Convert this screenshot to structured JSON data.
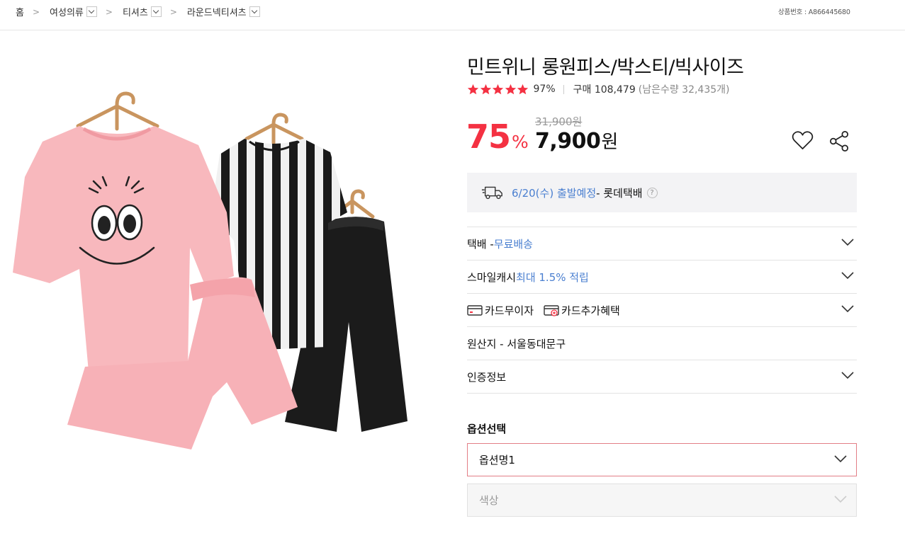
{
  "breadcrumb": {
    "items": [
      {
        "label": "홈",
        "has_dropdown": false
      },
      {
        "label": "여성의류",
        "has_dropdown": true
      },
      {
        "label": "티셔츠",
        "has_dropdown": true
      },
      {
        "label": "라운드넥티셔츠",
        "has_dropdown": true
      }
    ],
    "separator": ">"
  },
  "product_number": "상품번호 : A866445680",
  "product": {
    "title": "민트위니 롱원피스/박스티/빅사이즈",
    "rating_stars": 5,
    "rating_percent": "97%",
    "purchase_label": "구매 108,479",
    "remaining_label": "(남은수량 32,435개)",
    "discount_rate": "75",
    "discount_unit": "%",
    "original_price": "31,900원",
    "sale_price": "7,900",
    "currency": "원"
  },
  "shipping": {
    "date": "6/20(수) 출발예정",
    "carrier": " - 롯데택배",
    "help": "?"
  },
  "info_rows": {
    "delivery": {
      "label": "택배 - ",
      "value": "무료배송"
    },
    "smilecash": {
      "label": "스마일캐시 ",
      "value": "최대 1.5% 적립"
    },
    "card_installment": "카드무이자",
    "card_benefit": "카드추가혜택",
    "origin": "원산지 - 서울동대문구",
    "certification": "인증정보"
  },
  "options": {
    "title": "옵션선택",
    "select1": "옵션명1",
    "select2": "색상"
  },
  "colors": {
    "accent": "#f43142",
    "link_blue": "#4a7fd0",
    "star": "#f43142"
  },
  "icons": [
    "truck-icon",
    "heart-icon",
    "share-icon",
    "chevron-down-icon",
    "card-icon",
    "card-plus-icon",
    "star-icon"
  ]
}
